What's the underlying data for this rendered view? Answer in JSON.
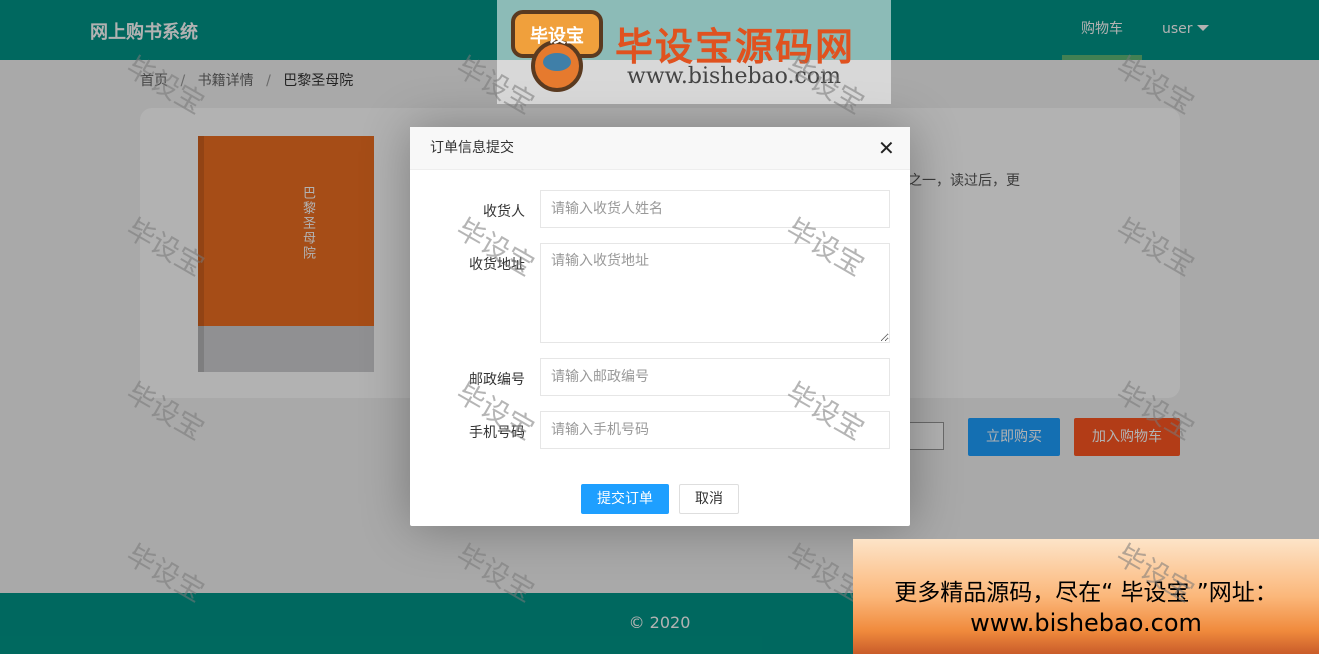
{
  "header": {
    "brand": "网上购书系统",
    "nav_cart": "购物车",
    "nav_user": "user"
  },
  "breadcrumb": {
    "home": "首页",
    "sep": "/",
    "detail": "书籍详情",
    "current": "巴黎圣母院"
  },
  "book": {
    "title": "巴黎圣母院",
    "description_fragment": "之一，读过后，更",
    "cover_color": "#ee6f22"
  },
  "actions": {
    "buy_now": "立即购买",
    "add_to_cart": "加入购物车"
  },
  "footer": {
    "copyright": "© 2020"
  },
  "modal": {
    "title": "订单信息提交",
    "fields": {
      "receiver_label": "收货人",
      "receiver_placeholder": "请输入收货人姓名",
      "address_label": "收货地址",
      "address_placeholder": "请输入收货地址",
      "zip_label": "邮政编号",
      "zip_placeholder": "请输入邮政编号",
      "phone_label": "手机号码",
      "phone_placeholder": "请输入手机号码"
    },
    "submit": "提交订单",
    "cancel": "取消"
  },
  "watermark": {
    "logo_text": "毕设宝",
    "site_name": "毕设宝源码网",
    "site_url": "www.bishebao.com",
    "tile_text": "毕设宝",
    "banner_line1": "更多精品源码，尽在“ 毕设宝 ”网址：",
    "banner_line2": "www.bishebao.com"
  },
  "colors": {
    "primary": "#009688",
    "blue": "#1E9FFF",
    "orange": "#FF5722"
  }
}
